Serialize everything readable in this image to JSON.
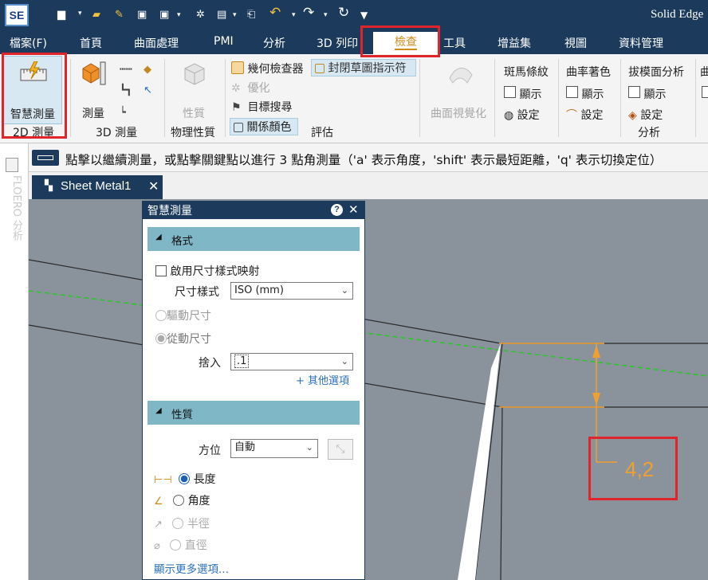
{
  "titlebar": {
    "logo": "SE",
    "app_title": "Solid Edge"
  },
  "quick_access": [
    "new-icon",
    "open-icon",
    "pin-icon",
    "save-icon",
    "save-as-icon",
    "settings-icon",
    "properties-icon",
    "exit-icon",
    "undo-icon",
    "redo-icon",
    "repeat-icon",
    "customize-icon"
  ],
  "menu": {
    "items": [
      "檔案(F)",
      "首頁",
      "曲面處理",
      "PMI",
      "分析",
      "3D 列印",
      "檢查",
      "工具",
      "增益集",
      "視圖",
      "資料管理"
    ],
    "active": "檢查"
  },
  "ribbon": {
    "smart_measure": "智慧測量",
    "group_2d": "2D 測量",
    "measure": "測量",
    "group_3d": "3D 測量",
    "properties": "性質",
    "group_physical": "物理性質",
    "geometry_inspector": "幾何檢查器",
    "closed_sketch_indicator": "封閉草圖指示符",
    "optimize": "優化",
    "target_search": "目標搜尋",
    "relation_color": "關係顏色",
    "group_eval": "評估",
    "surface_visualize": "曲面視覺化",
    "zebra": "斑馬條紋",
    "zebra_show": "顯示",
    "zebra_settings": "設定",
    "curvature": "曲率著色",
    "curvature_show": "顯示",
    "curvature_settings": "設定",
    "draft": "拔模面分析",
    "draft_show": "顯示",
    "draft_settings": "設定",
    "group_analysis": "分析",
    "partial_next": "曲"
  },
  "command_bar": {
    "prompt": "點擊以繼續測量，或點擊關鍵點以進行 3 點角測量（'a' 表示角度，'shift' 表示最短距離，'q' 表示切換定位）"
  },
  "doc_tab": {
    "label": "Sheet Metal1"
  },
  "sidebar": {
    "vertical_text": "FLOERO 分析"
  },
  "dialog": {
    "title": "智慧測量",
    "help": "?",
    "close": "✕",
    "format_section": "格式",
    "enable_dim_style_map": "啟用尺寸樣式映射",
    "dim_style_label": "尺寸樣式",
    "dim_style_value": "ISO (mm)",
    "driving_dim": "驅動尺寸",
    "driven_dim": "從動尺寸",
    "round_label": "捨入",
    "round_value": ".1",
    "more_options": "+ 其他選項",
    "props_section": "性質",
    "orientation_label": "方位",
    "orientation_value": "自動",
    "length": "長度",
    "angle": "角度",
    "radius": "半徑",
    "diameter": "直徑",
    "show_more": "顯示更多選項..."
  },
  "measurement": {
    "value": "4,2"
  },
  "colors": {
    "titlebar": "#1b3a5c",
    "accent": "#d08a18",
    "highlight": "#e0242b",
    "dimension": "#f0a030",
    "centerline": "#2ec42e",
    "viewport": "#8a939b"
  }
}
